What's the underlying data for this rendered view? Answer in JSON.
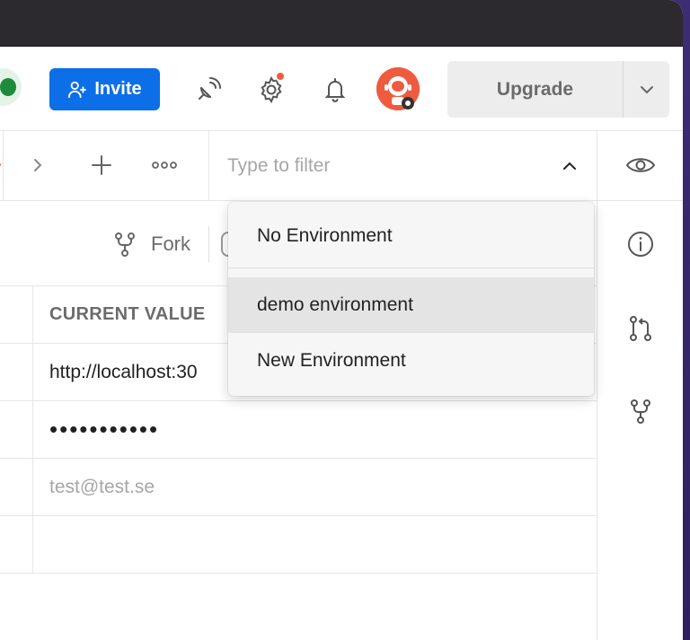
{
  "topbar": {
    "invite_label": "Invite",
    "upgrade_label": "Upgrade"
  },
  "env": {
    "filter_placeholder": "Type to filter",
    "options": [
      {
        "label": "No Environment"
      },
      {
        "label": "demo environment"
      },
      {
        "label": "New Environment"
      }
    ]
  },
  "header": {
    "fork_label": "Fork"
  },
  "table": {
    "column_header": "CURRENT VALUE",
    "rows": [
      {
        "value": "http://localhost:30"
      },
      {
        "value": "•••••••••••"
      },
      {
        "value": "test@test.se"
      },
      {
        "value": ""
      }
    ]
  },
  "colors": {
    "accent": "#0d6fe8",
    "brand": "#ef5b3f"
  }
}
